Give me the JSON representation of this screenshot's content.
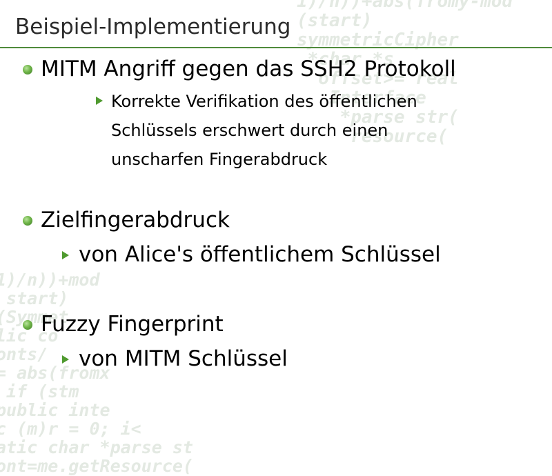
{
  "slide": {
    "title": "Beispiel-Implementierung",
    "items": [
      {
        "text": "MITM Angriff gegen das SSH2 Protokoll",
        "sub": [
          {
            "lines": [
              "Korrekte Verifikation des öffentlichen",
              "Schlüssels erschwert durch einen",
              "unscharfen Fingerabdruck"
            ]
          }
        ]
      },
      {
        "text": "Zielfingerabdruck",
        "sub": [
          {
            "text": "von Alice's öffentlichem Schlüssel"
          }
        ]
      },
      {
        "text": "Fuzzy Fingerprint",
        "sub": [
          {
            "text": "von MITM Schlüssel"
          }
        ]
      }
    ]
  },
  "colors": {
    "accent": "#4f8a3b",
    "bullet": "#6fb548",
    "sub_arrow": "#4f9a2f",
    "background_code": "#e3e9e2"
  }
}
